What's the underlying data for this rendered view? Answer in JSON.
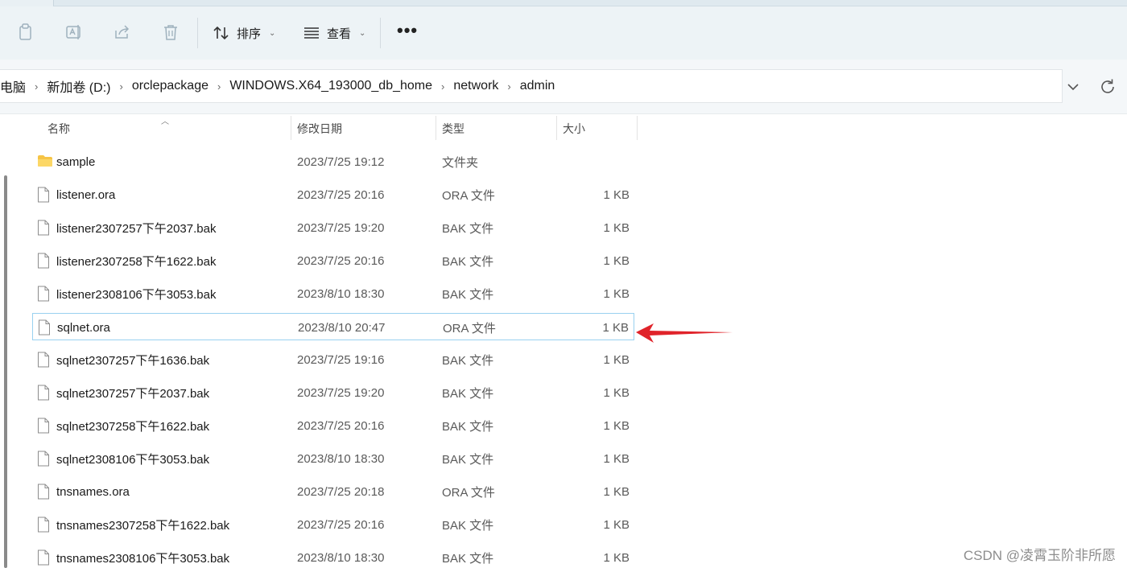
{
  "toolbar": {
    "sort_label": "排序",
    "view_label": "查看",
    "more_label": "•••"
  },
  "breadcrumb": [
    "电脑",
    "新加卷 (D:)",
    "orclepackage",
    "WINDOWS.X64_193000_db_home",
    "network",
    "admin"
  ],
  "columns": {
    "name": "名称",
    "modified": "修改日期",
    "type": "类型",
    "size": "大小"
  },
  "files": [
    {
      "name": "sample",
      "date": "2023/7/25 19:12",
      "type": "文件夹",
      "size": "",
      "icon": "folder-icon"
    },
    {
      "name": "listener.ora",
      "date": "2023/7/25 20:16",
      "type": "ORA 文件",
      "size": "1 KB",
      "icon": "file-icon"
    },
    {
      "name": "listener2307257下午2037.bak",
      "date": "2023/7/25 19:20",
      "type": "BAK 文件",
      "size": "1 KB",
      "icon": "file-icon"
    },
    {
      "name": "listener2307258下午1622.bak",
      "date": "2023/7/25 20:16",
      "type": "BAK 文件",
      "size": "1 KB",
      "icon": "file-icon"
    },
    {
      "name": "listener2308106下午3053.bak",
      "date": "2023/8/10 18:30",
      "type": "BAK 文件",
      "size": "1 KB",
      "icon": "file-icon"
    },
    {
      "name": "sqlnet.ora",
      "date": "2023/8/10 20:47",
      "type": "ORA 文件",
      "size": "1 KB",
      "icon": "file-icon",
      "selected": true
    },
    {
      "name": "sqlnet2307257下午1636.bak",
      "date": "2023/7/25 19:16",
      "type": "BAK 文件",
      "size": "1 KB",
      "icon": "file-icon"
    },
    {
      "name": "sqlnet2307257下午2037.bak",
      "date": "2023/7/25 19:20",
      "type": "BAK 文件",
      "size": "1 KB",
      "icon": "file-icon"
    },
    {
      "name": "sqlnet2307258下午1622.bak",
      "date": "2023/7/25 20:16",
      "type": "BAK 文件",
      "size": "1 KB",
      "icon": "file-icon"
    },
    {
      "name": "sqlnet2308106下午3053.bak",
      "date": "2023/8/10 18:30",
      "type": "BAK 文件",
      "size": "1 KB",
      "icon": "file-icon"
    },
    {
      "name": "tnsnames.ora",
      "date": "2023/7/25 20:18",
      "type": "ORA 文件",
      "size": "1 KB",
      "icon": "file-icon"
    },
    {
      "name": "tnsnames2307258下午1622.bak",
      "date": "2023/7/25 20:16",
      "type": "BAK 文件",
      "size": "1 KB",
      "icon": "file-icon"
    },
    {
      "name": "tnsnames2308106下午3053.bak",
      "date": "2023/8/10 18:30",
      "type": "BAK 文件",
      "size": "1 KB",
      "icon": "file-icon"
    }
  ],
  "watermark": "CSDN @凌霄玉阶非所愿",
  "colors": {
    "selection_border": "#99d1f0",
    "annotation_arrow": "#e0232a",
    "folder": "#f6c445"
  }
}
